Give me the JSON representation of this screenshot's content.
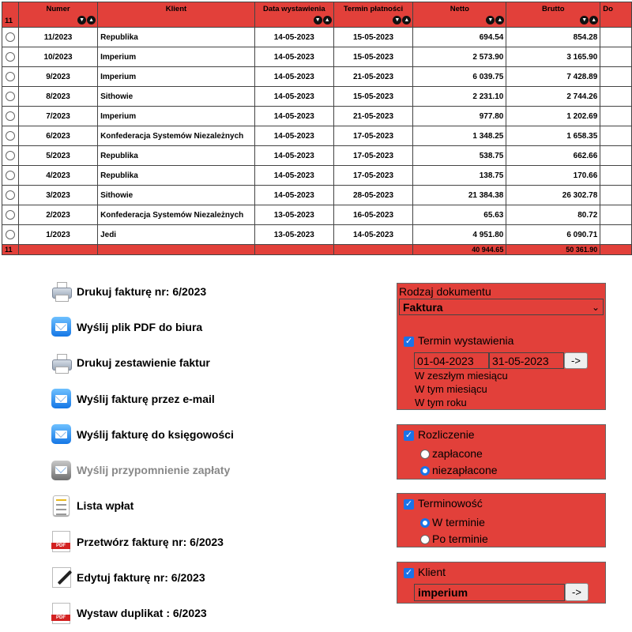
{
  "table": {
    "row_count": "11",
    "headers": [
      "Numer",
      "Klient",
      "Data wystawienia",
      "Termin płatności",
      "Netto",
      "Brutto",
      "Do"
    ],
    "rows": [
      [
        "11/2023",
        "Republika",
        "14-05-2023",
        "15-05-2023",
        "694.54",
        "854.28"
      ],
      [
        "10/2023",
        "Imperium",
        "14-05-2023",
        "15-05-2023",
        "2 573.90",
        "3 165.90"
      ],
      [
        "9/2023",
        "Imperium",
        "14-05-2023",
        "21-05-2023",
        "6 039.75",
        "7 428.89"
      ],
      [
        "8/2023",
        "Sithowie",
        "14-05-2023",
        "15-05-2023",
        "2 231.10",
        "2 744.26"
      ],
      [
        "7/2023",
        "Imperium",
        "14-05-2023",
        "21-05-2023",
        "977.80",
        "1 202.69"
      ],
      [
        "6/2023",
        "Konfederacja Systemów Niezależnych",
        "14-05-2023",
        "17-05-2023",
        "1 348.25",
        "1 658.35"
      ],
      [
        "5/2023",
        "Republika",
        "14-05-2023",
        "17-05-2023",
        "538.75",
        "662.66"
      ],
      [
        "4/2023",
        "Republika",
        "14-05-2023",
        "17-05-2023",
        "138.75",
        "170.66"
      ],
      [
        "3/2023",
        "Sithowie",
        "14-05-2023",
        "28-05-2023",
        "21 384.38",
        "26 302.78"
      ],
      [
        "2/2023",
        "Konfederacja Systemów Niezależnych",
        "13-05-2023",
        "16-05-2023",
        "65.63",
        "80.72"
      ],
      [
        "1/2023",
        "Jedi",
        "13-05-2023",
        "14-05-2023",
        "4 951.80",
        "6 090.71"
      ]
    ],
    "footer": {
      "count": "11",
      "netto_total": "40 944.65",
      "brutto_total": "50 361.90"
    }
  },
  "actions": [
    {
      "label": "Drukuj fakturę nr: 6/2023",
      "icon": "printer-icon"
    },
    {
      "label": "Wyślij plik PDF do biura",
      "icon": "mail-icon"
    },
    {
      "label": "Drukuj zestawienie faktur",
      "icon": "printer-icon"
    },
    {
      "label": "Wyślij fakturę przez e-mail",
      "icon": "mail-icon"
    },
    {
      "label": "Wyślij fakturę do księgowości",
      "icon": "mail-icon"
    },
    {
      "label": "Wyślij przypomnienie zapłaty",
      "icon": "mail-icon-disabled"
    },
    {
      "label": "Lista wpłat",
      "icon": "list-icon"
    },
    {
      "label": "Przetwórz fakturę nr: 6/2023",
      "icon": "pdf-icon"
    },
    {
      "label": "Edytuj fakturę nr: 6/2023",
      "icon": "edit-icon"
    },
    {
      "label": "Wystaw duplikat : 6/2023",
      "icon": "pdf-icon"
    }
  ],
  "filters": {
    "doc_type_label": "Rodzaj dokumentu",
    "doc_type_value": "Faktura",
    "issue_date_label": "Termin wystawienia",
    "date_from": "01-04-2023",
    "date_to": "31-05-2023",
    "go": "->",
    "quick": [
      "W zeszłym miesiącu",
      "W tym miesiącu",
      "W tym roku"
    ],
    "settlement_label": "Rozliczenie",
    "settlement_options": [
      "zapłacone",
      "niezapłacone"
    ],
    "settlement_selected": "niezapłacone",
    "timeliness_label": "Terminowość",
    "timeliness_options": [
      "W terminie",
      "Po terminie"
    ],
    "timeliness_selected": "W terminie",
    "client_label": "Klient",
    "client_value": "imperium"
  },
  "colors": {
    "accent": "#e2403a",
    "checkbox": "#1a73e8"
  }
}
